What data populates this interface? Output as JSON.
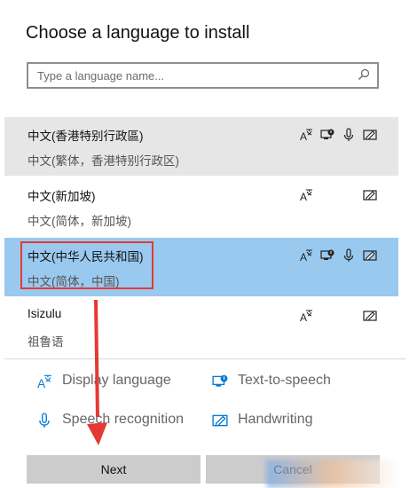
{
  "dialog": {
    "title": "Choose a language to install",
    "search": {
      "placeholder": "Type a language name..."
    }
  },
  "languages": [
    {
      "name": "中文(香港特别行政區)",
      "sub": "中文(繁体，香港特别行政区)",
      "state": "hover",
      "features": [
        "display-language",
        "text-to-speech",
        "speech-recognition",
        "handwriting"
      ]
    },
    {
      "name": "中文(新加坡)",
      "sub": "中文(简体，新加坡)",
      "state": "normal",
      "features": [
        "display-language",
        "handwriting"
      ]
    },
    {
      "name": "中文(中华人民共和国)",
      "sub": "中文(简体，中国)",
      "state": "selected",
      "features": [
        "display-language",
        "text-to-speech",
        "speech-recognition",
        "handwriting"
      ]
    },
    {
      "name": "Isizulu",
      "sub": "祖鲁语",
      "state": "normal",
      "features": [
        "display-language",
        "handwriting"
      ]
    }
  ],
  "legend": {
    "display_language": "Display language",
    "text_to_speech": "Text-to-speech",
    "speech_recognition": "Speech recognition",
    "handwriting": "Handwriting"
  },
  "buttons": {
    "next": "Next",
    "cancel": "Cancel"
  },
  "colors": {
    "selected": "#99c9ef",
    "hover": "#e6e6e6",
    "annotation": "#e53935",
    "accent": "#0078d7"
  }
}
